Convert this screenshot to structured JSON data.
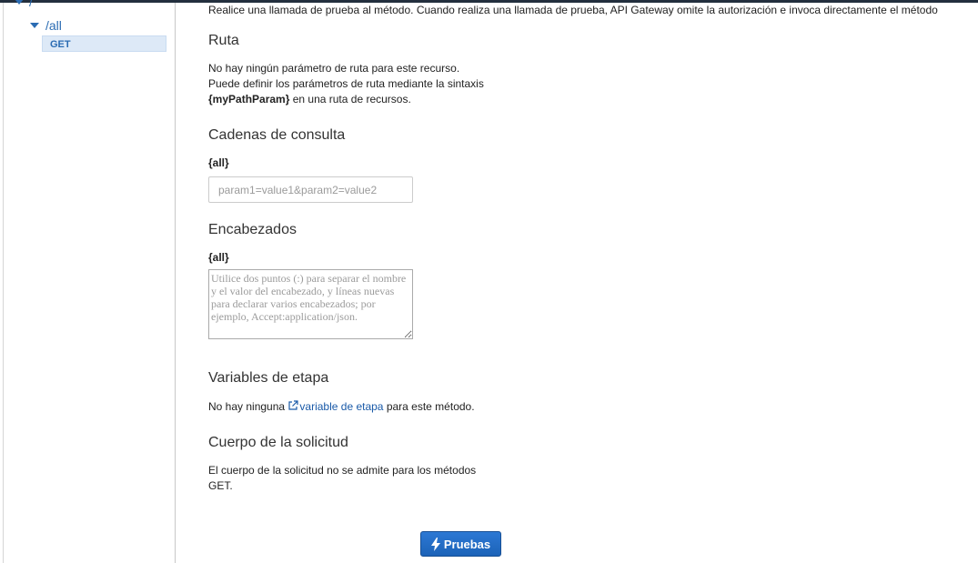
{
  "sidebar": {
    "root_label": "/",
    "resource_label": "/all",
    "method_label": "GET"
  },
  "main": {
    "intro": "Realice una llamada de prueba al método. Cuando realiza una llamada de prueba, API Gateway omite la autorización e invoca directamente el método",
    "path": {
      "title": "Ruta",
      "line1": "No hay ningún parámetro de ruta para este recurso.",
      "line2": "Puede definir los parámetros de ruta mediante la sintaxis",
      "line3_bold": "{myPathParam}",
      "line3_rest": " en una ruta de recursos."
    },
    "query": {
      "title": "Cadenas de consulta",
      "label": "{all}",
      "value": "",
      "placeholder": "param1=value1&param2=value2"
    },
    "headers": {
      "title": "Encabezados",
      "label": "{all}",
      "value": "",
      "placeholder": "Utilice dos puntos (:) para separar el nombre y el valor del encabezado, y líneas nuevas para declarar varios encabezados; por ejemplo, Accept:application/json."
    },
    "stage": {
      "title": "Variables de etapa",
      "prefix": "No hay ninguna ",
      "link": "variable de etapa",
      "suffix": " para este método."
    },
    "body": {
      "title": "Cuerpo de la solicitud",
      "line1": "El cuerpo de la solicitud no se admite para los métodos",
      "line2": "GET."
    },
    "test_button_label": "Pruebas"
  },
  "icons": {
    "tree_expand": "caret-down-icon",
    "external_link": "external-link-icon",
    "bolt": "lightning-bolt-icon"
  },
  "colors": {
    "link": "#1a5aa8",
    "button": "#1f6ac3",
    "selected_row": "#dde9f7"
  }
}
